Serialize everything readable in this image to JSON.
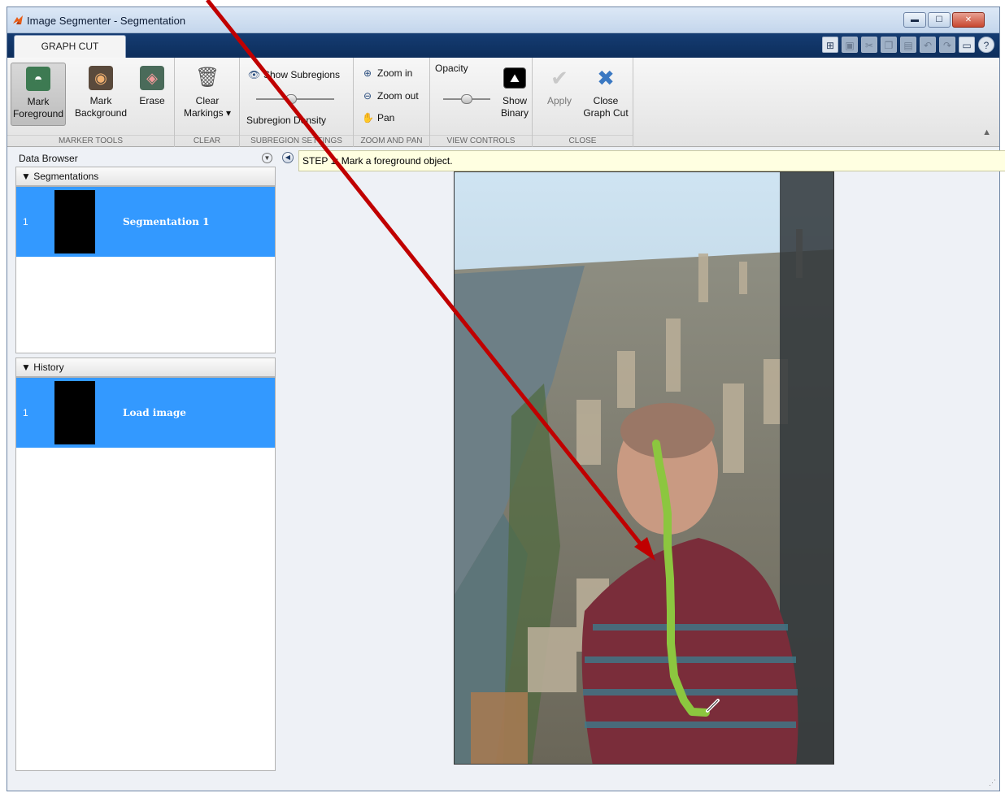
{
  "window": {
    "title": "Image Segmenter - Segmentation",
    "controls": [
      "minimize",
      "maximize",
      "close"
    ]
  },
  "tabs": [
    {
      "label": "GRAPH CUT",
      "active": true
    }
  ],
  "quick_access": [
    "insert-icon",
    "save-icon",
    "cut-icon",
    "copy-icon",
    "paste-icon",
    "undo-icon",
    "redo-icon",
    "layout-icon",
    "help-icon"
  ],
  "toolstrip": {
    "marker_tools": {
      "label": "MARKER TOOLS",
      "mark_foreground_1": "Mark",
      "mark_foreground_2": "Foreground",
      "mark_background_1": "Mark",
      "mark_background_2": "Background",
      "erase": "Erase"
    },
    "clear": {
      "label": "CLEAR",
      "clear_markings_1": "Clear",
      "clear_markings_2": "Markings"
    },
    "subregion_settings": {
      "label": "SUBREGION SETTINGS",
      "show_subregions": "Show Subregions",
      "subregion_density": "Subregion Density",
      "density_level": 0.45
    },
    "zoom_and_pan": {
      "label": "ZOOM AND PAN",
      "zoom_in": "Zoom in",
      "zoom_out": "Zoom out",
      "pan": "Pan"
    },
    "view_controls": {
      "label": "VIEW CONTROLS",
      "opacity": "Opacity",
      "opacity_level": 0.5,
      "show_binary_1": "Show",
      "show_binary_2": "Binary"
    },
    "close": {
      "label": "CLOSE",
      "apply": "Apply",
      "close_graph_cut_1": "Close",
      "close_graph_cut_2": "Graph Cut"
    }
  },
  "data_browser": {
    "title": "Data Browser",
    "segmentations": {
      "heading": "Segmentations",
      "items": [
        {
          "num": "1",
          "label": "Segmentation 1"
        }
      ]
    },
    "history": {
      "heading": "History",
      "items": [
        {
          "num": "1",
          "label": "Load image"
        }
      ]
    }
  },
  "canvas": {
    "instruction": "STEP 1: Mark a foreground object."
  },
  "colors": {
    "selection": "#3399ff",
    "foreground_marker": "#8cc63f",
    "annotation_arrow": "#c00000",
    "info_bar": "#ffffe1"
  }
}
